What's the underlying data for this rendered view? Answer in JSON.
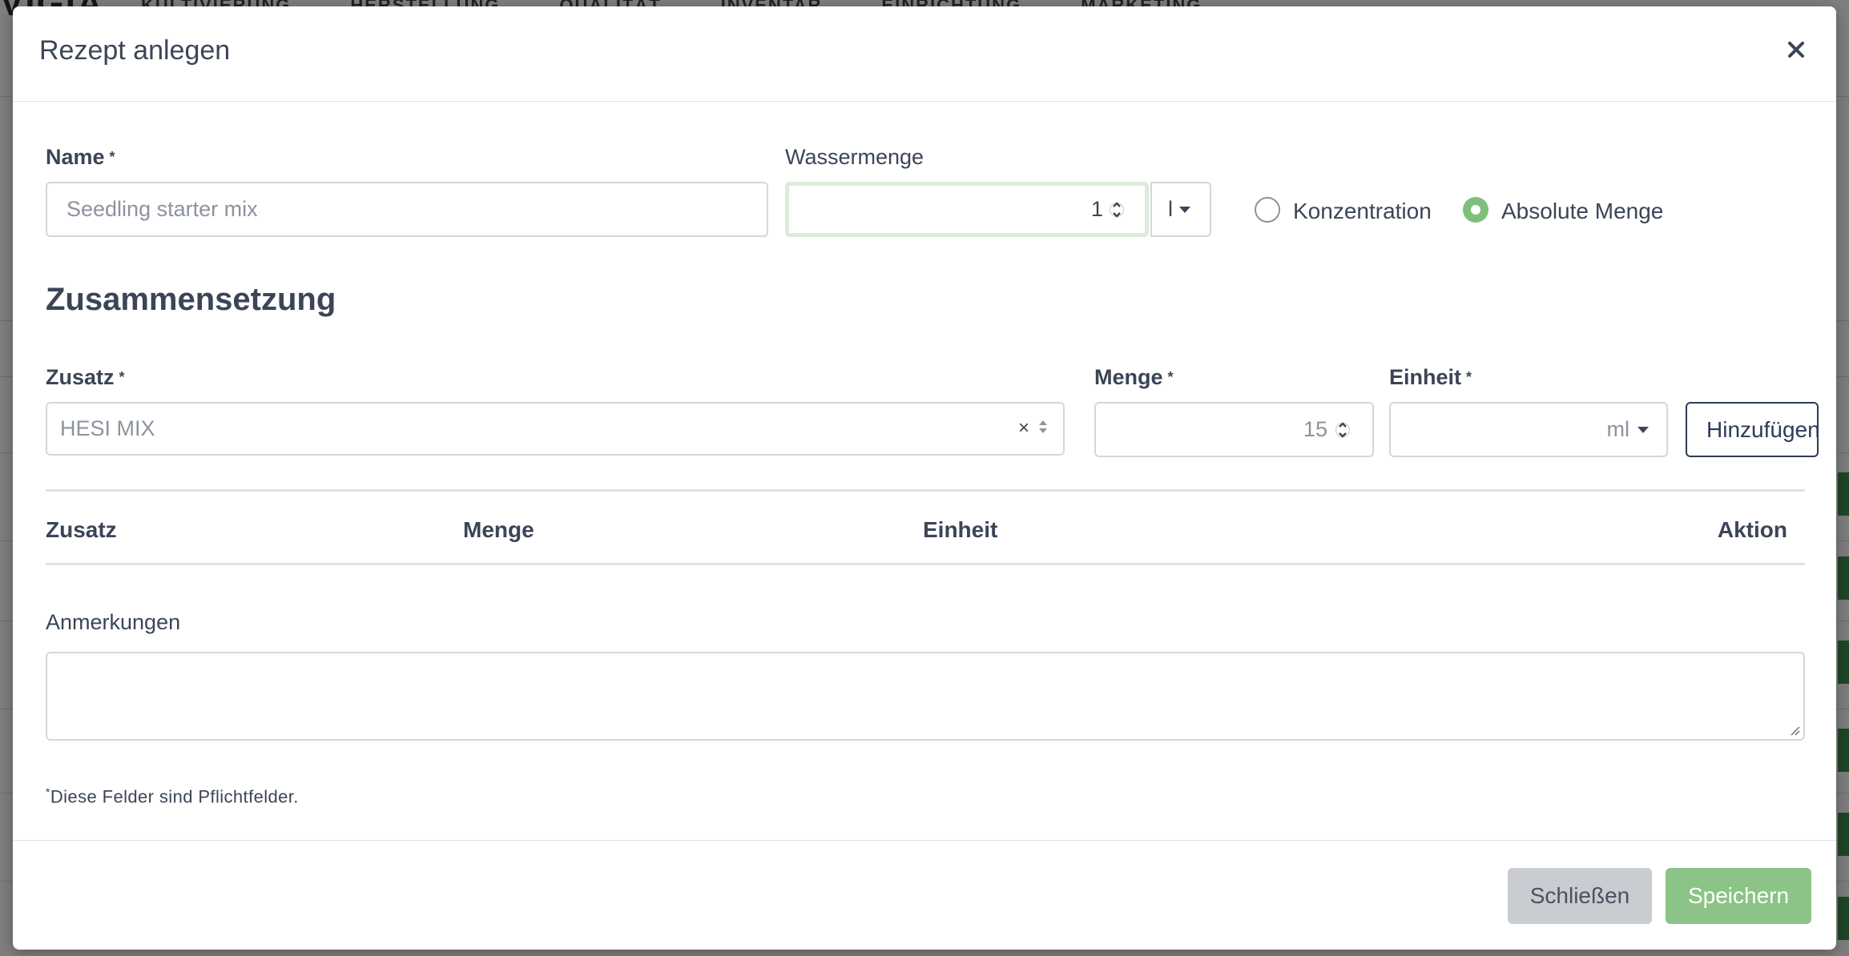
{
  "background": {
    "logo": "VIGIA",
    "nav": [
      "KULTIVIERUNG",
      "HERSTELLUNG",
      "QUALITÄT",
      "INVENTAR",
      "EINRICHTUNG",
      "MARKETING"
    ]
  },
  "modal": {
    "title": "Rezept anlegen",
    "close_icon": "close-icon",
    "name": {
      "label": "Name",
      "placeholder": "Seedling starter mix",
      "required_mark": "*"
    },
    "water": {
      "label": "Wassermenge",
      "value": "1",
      "unit": "l"
    },
    "mode": {
      "options": [
        {
          "label": "Konzentration",
          "checked": false
        },
        {
          "label": "Absolute Menge",
          "checked": true
        }
      ]
    },
    "composition": {
      "title": "Zusammensetzung",
      "additive": {
        "label": "Zusatz",
        "value": "HESI MIX",
        "required_mark": "*"
      },
      "amount": {
        "label": "Menge",
        "value": "15",
        "required_mark": "*"
      },
      "unit": {
        "label": "Einheit",
        "value": "ml",
        "required_mark": "*"
      },
      "add_button": "Hinzufügen",
      "table_headers": [
        "Zusatz",
        "Menge",
        "Einheit",
        "Aktion"
      ]
    },
    "notes": {
      "label": "Anmerkungen",
      "value": ""
    },
    "footnote": {
      "mark": "*",
      "text": "Diese Felder sind Pflichtfelder."
    },
    "footer": {
      "close_label": "Schließen",
      "save_label": "Speichern"
    },
    "colors": {
      "accent_green": "#8bc486",
      "radio_green": "#7fbf7b",
      "text": "#3b4557"
    }
  }
}
